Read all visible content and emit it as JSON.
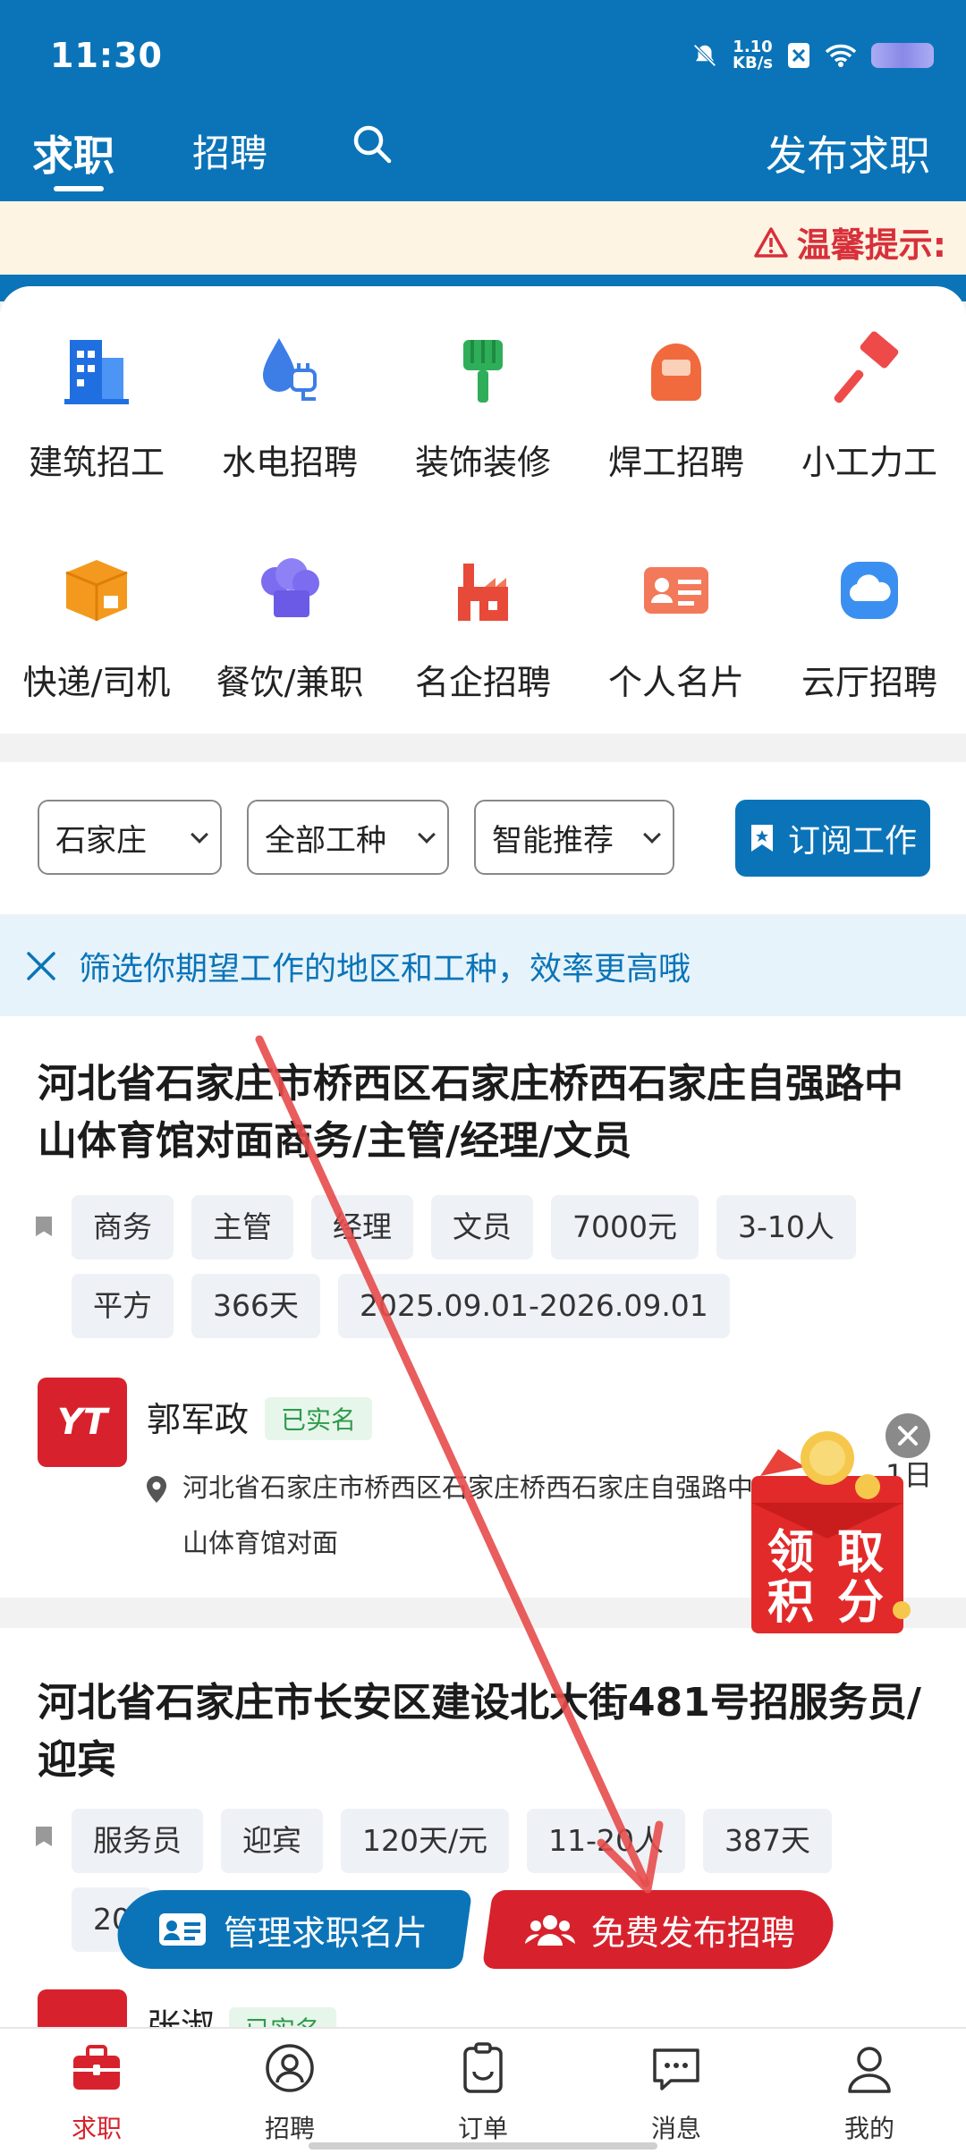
{
  "status_bar": {
    "time": "11:30",
    "net_speed_top": "1.10",
    "net_speed_bottom": "KB/s"
  },
  "header": {
    "tabs": [
      {
        "label": "求职",
        "active": true
      },
      {
        "label": "招聘",
        "active": false
      }
    ],
    "publish_label": "发布求职",
    "accent_color": "#0b74b8"
  },
  "notice": {
    "text": "温馨提示:"
  },
  "categories": [
    {
      "label": "建筑招工",
      "icon": "building-icon"
    },
    {
      "label": "水电招聘",
      "icon": "water-electric-icon"
    },
    {
      "label": "装饰装修",
      "icon": "paint-roller-icon"
    },
    {
      "label": "焊工招聘",
      "icon": "welding-mask-icon"
    },
    {
      "label": "小工力工",
      "icon": "hammer-icon"
    },
    {
      "label": "快递/司机",
      "icon": "package-icon"
    },
    {
      "label": "餐饮/兼职",
      "icon": "chef-hat-icon"
    },
    {
      "label": "名企招聘",
      "icon": "factory-icon"
    },
    {
      "label": "个人名片",
      "icon": "business-card-icon"
    },
    {
      "label": "云厅招聘",
      "icon": "cloud-icon"
    }
  ],
  "filters": {
    "city": "石家庄",
    "work_type": "全部工种",
    "sort": "智能推荐",
    "subscribe_label": "订阅工作"
  },
  "tip": {
    "text": "筛选你期望工作的地区和工种，效率更高哦"
  },
  "jobs": [
    {
      "title": "河北省石家庄市桥西区石家庄桥西石家庄自强路中山体育馆对面商务/主管/经理/文员",
      "tags": [
        "商务",
        "主管",
        "经理",
        "文员",
        "7000元",
        "3-10人",
        "平方",
        "366天",
        "2025.09.01-2026.09.01"
      ],
      "user": "郭军政",
      "verified": "已实名",
      "logo_text": "YT",
      "address": "河北省石家庄市桥西区石家庄桥西石家庄自强路中山体育馆对面",
      "date_fragment": "1日"
    },
    {
      "title": "河北省石家庄市长安区建设北大街481号招服务员/迎宾",
      "tags": [
        "服务员",
        "迎宾",
        "120天/元",
        "11-20人",
        "387天",
        "20"
      ],
      "user": "张淑",
      "verified": "已实名"
    }
  ],
  "reward": {
    "text_line1": "领 取",
    "text_line2": "积 分"
  },
  "actions": {
    "manage_label": "管理求职名片",
    "free_publish_label": "免费发布招聘"
  },
  "bottom_nav": [
    {
      "label": "求职",
      "icon": "briefcase-icon",
      "active": true
    },
    {
      "label": "招聘",
      "icon": "person-circle-icon",
      "active": false
    },
    {
      "label": "订单",
      "icon": "clipboard-icon",
      "active": false
    },
    {
      "label": "消息",
      "icon": "chat-bubble-icon",
      "active": false
    },
    {
      "label": "我的",
      "icon": "user-icon",
      "active": false
    }
  ]
}
